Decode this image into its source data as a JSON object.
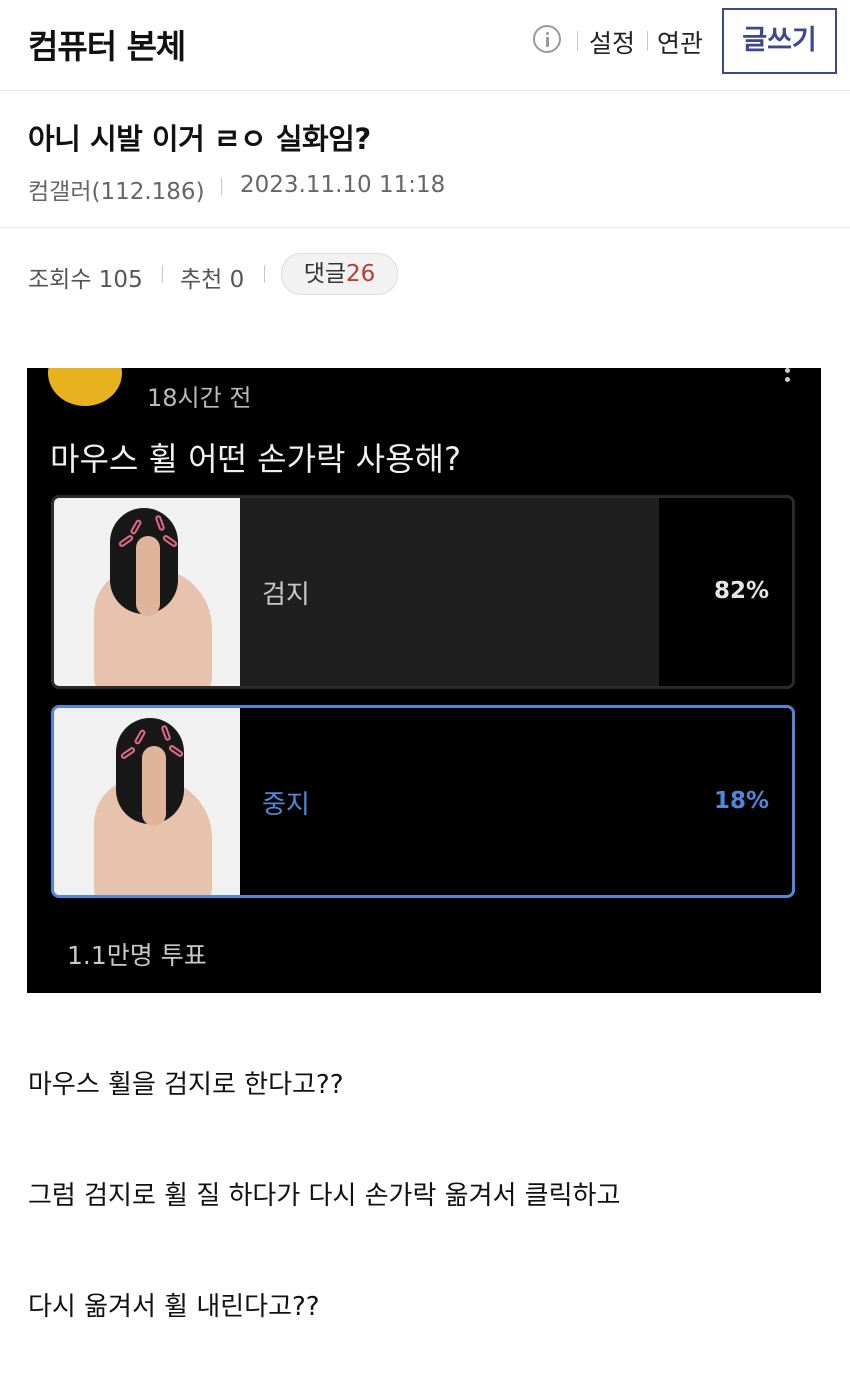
{
  "header": {
    "gallery_name": "컴퓨터 본체",
    "info_icon": "info-circle-icon",
    "links": [
      "설정",
      "연관"
    ],
    "write_label": "글쓰기",
    "accent_color": "#3b4890"
  },
  "post": {
    "title": "아니 시발 이거 ㄹㅇ 실화임?",
    "author": "컴갤러(112.186)",
    "datetime": "2023.11.10 11:18",
    "views_label": "조회수",
    "views": "105",
    "recommend_label": "추천",
    "recommend": "0",
    "comments_label": "댓글",
    "comments": "26"
  },
  "poll": {
    "time_ago": "18시간 전",
    "question": "마우스 휠 어떤 손가락 사용해?",
    "options": [
      {
        "label": "검지",
        "percent_text": "82%",
        "percent": 82,
        "selected": false
      },
      {
        "label": "중지",
        "percent_text": "18%",
        "percent": 18,
        "selected": true
      }
    ],
    "votes": "1.1만명 투표",
    "highlight_color": "#4f88d6"
  },
  "body_lines": [
    "마우스 휠을 검지로 한다고??",
    "그럼 검지로 휠 질 하다가 다시 손가락 옮겨서 클릭하고",
    "다시 옮겨서 휠 내린다고??"
  ]
}
